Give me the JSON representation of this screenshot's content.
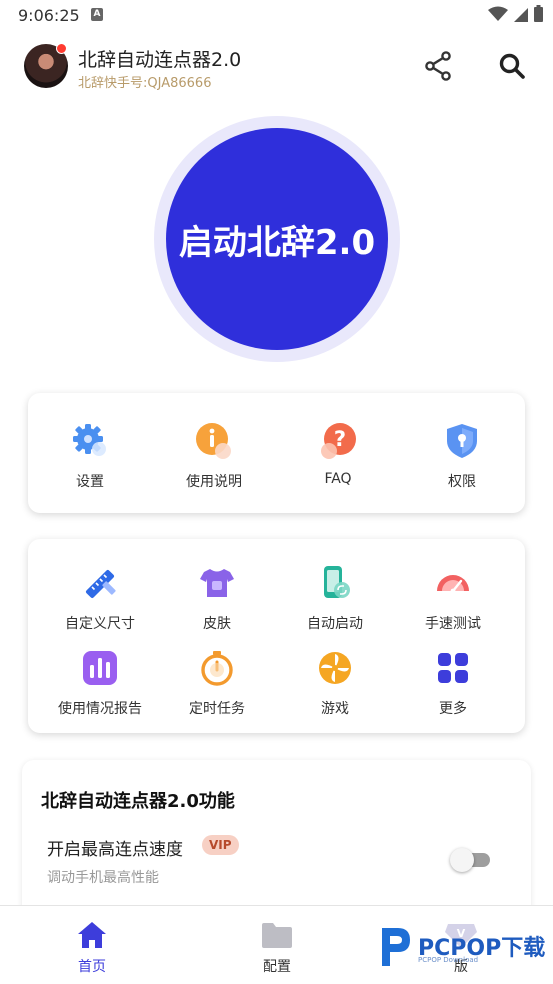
{
  "status": {
    "time": "9:06:25",
    "notif_letter": "A"
  },
  "header": {
    "title": "北辞自动连点器2.0",
    "subtitle": "北辞快手号:QJA86666"
  },
  "start_button": {
    "label": "启动北辞2.0"
  },
  "quick_menu": [
    {
      "label": "设置",
      "icon": "gear-icon"
    },
    {
      "label": "使用说明",
      "icon": "info-icon"
    },
    {
      "label": "FAQ",
      "icon": "question-icon"
    },
    {
      "label": "权限",
      "icon": "shield-lock-icon"
    }
  ],
  "tools_menu": [
    {
      "label": "自定义尺寸",
      "icon": "ruler-pencil-icon"
    },
    {
      "label": "皮肤",
      "icon": "tshirt-icon"
    },
    {
      "label": "自动启动",
      "icon": "phone-sync-icon"
    },
    {
      "label": "手速测试",
      "icon": "speedometer-icon"
    },
    {
      "label": "使用情况报告",
      "icon": "bar-chart-icon"
    },
    {
      "label": "定时任务",
      "icon": "stopwatch-icon"
    },
    {
      "label": "游戏",
      "icon": "pinwheel-icon"
    },
    {
      "label": "更多",
      "icon": "grid-icon"
    }
  ],
  "features": {
    "title": "北辞自动连点器2.0功能",
    "rows": [
      {
        "title": "开启最高连点速度",
        "badge": "VIP",
        "desc": "调动手机最高性能",
        "enabled": false
      }
    ]
  },
  "bottom_nav": [
    {
      "label": "首页",
      "icon": "home-icon",
      "active": true
    },
    {
      "label": "配置",
      "icon": "folder-icon",
      "active": false
    },
    {
      "label": "版",
      "icon": "vip-icon",
      "active": false
    }
  ],
  "watermark": {
    "brand": "PCPOP",
    "suffix": "下载",
    "sub": "PCPOP Download"
  },
  "colors": {
    "accent": "#2f2fdb",
    "nav_active": "#3d3ddb",
    "vip_bg": "#f7d0c4",
    "subtitle": "#b89b6a"
  }
}
